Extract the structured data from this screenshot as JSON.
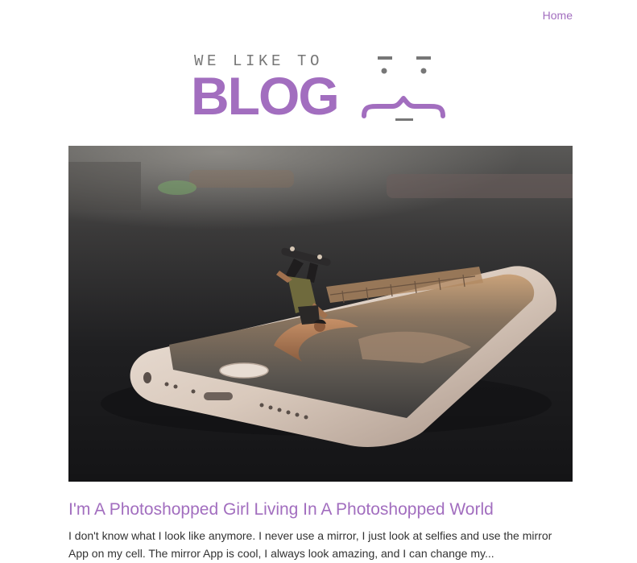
{
  "nav": {
    "home_label": "Home"
  },
  "logo": {
    "tagline": "WE LIKE TO",
    "word": "BLOG",
    "face_icon": "kaomoji-face-icon"
  },
  "post": {
    "image_icon": "skateboarder-on-phone-photo",
    "title": "I'm A Photoshopped Girl Living In A Photoshopped World",
    "excerpt": "I don't know what I look like anymore. I never use a mirror, I just look at selfies and use the mirror App on my cell. The mirror App is cool, I always look amazing, and I can change my..."
  },
  "colors": {
    "accent": "#a26ebf",
    "logo_gray": "#777777",
    "text": "#333333"
  }
}
